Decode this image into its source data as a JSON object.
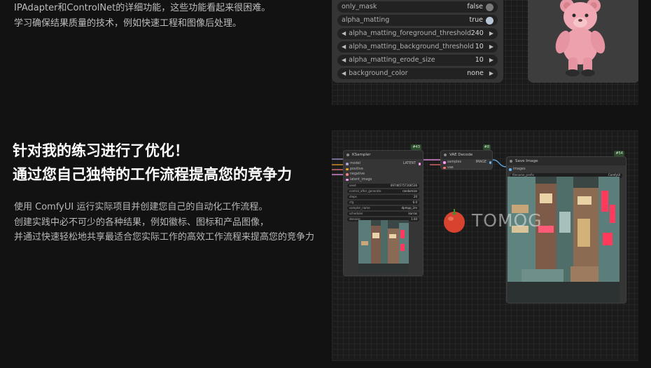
{
  "intro": {
    "line1": "IPAdapter和ControlNet的详细功能，这些功能看起来很困难。",
    "line2": "学习确保结果质量的技术，例如快速工程和图像后处理。"
  },
  "headline": {
    "line1": "针对我的练习进行了优化！",
    "line2": "通过您自己独特的工作流程提高您的竞争力"
  },
  "body": {
    "line1": "使用 ComfyUI 运行实际项目并创建您自己的自动化工作流程。",
    "line2": "创建实践中必不可少的各种结果，例如徽标、图标和产品图像，",
    "line3": "并通过快速轻松地共享最适合您实际工作的高效工作流程来提高您的竞争力"
  },
  "rembg_node": {
    "toggles": [
      {
        "label": "only_mask",
        "value": "false",
        "on": false
      },
      {
        "label": "alpha_matting",
        "value": "true",
        "on": true
      }
    ],
    "numbers": [
      {
        "label": "alpha_matting_foreground_threshold",
        "value": "240"
      },
      {
        "label": "alpha_matting_background_threshold",
        "value": "10"
      },
      {
        "label": "alpha_matting_erode_size",
        "value": "10"
      },
      {
        "label": "background_color",
        "value": "none"
      }
    ]
  },
  "workflow": {
    "ksampler": {
      "badge": "#43",
      "title": "KSampler",
      "inputs": [
        "model",
        "positive",
        "negative",
        "latent_image"
      ],
      "output": "LATENT",
      "widgets": [
        {
          "label": "seed",
          "value": "697465757166536"
        },
        {
          "label": "control_after_generate",
          "value": "randomize"
        },
        {
          "label": "steps",
          "value": "20"
        },
        {
          "label": "cfg",
          "value": "6.0"
        },
        {
          "label": "sampler_name",
          "value": "dpmpp_2m"
        },
        {
          "label": "scheduler",
          "value": "karras"
        },
        {
          "label": "denoise",
          "value": "1.00"
        }
      ]
    },
    "vae_decode": {
      "badge": "#8",
      "title": "VAE Decode",
      "inputs": [
        "samples",
        "vae"
      ],
      "output": "IMAGE"
    },
    "save_image": {
      "badge": "#54",
      "title": "Save Image",
      "inputs": [
        "images"
      ],
      "widget": {
        "label": "filename_prefix",
        "value": "ComfyUI"
      }
    },
    "watermark": "TOMOG"
  },
  "colors": {
    "model": "#b39ddb",
    "positive": "#f5a623",
    "negative": "#f08080",
    "latent": "#ff9cf9",
    "vae": "#ff6e6e",
    "image": "#64b5f6"
  }
}
